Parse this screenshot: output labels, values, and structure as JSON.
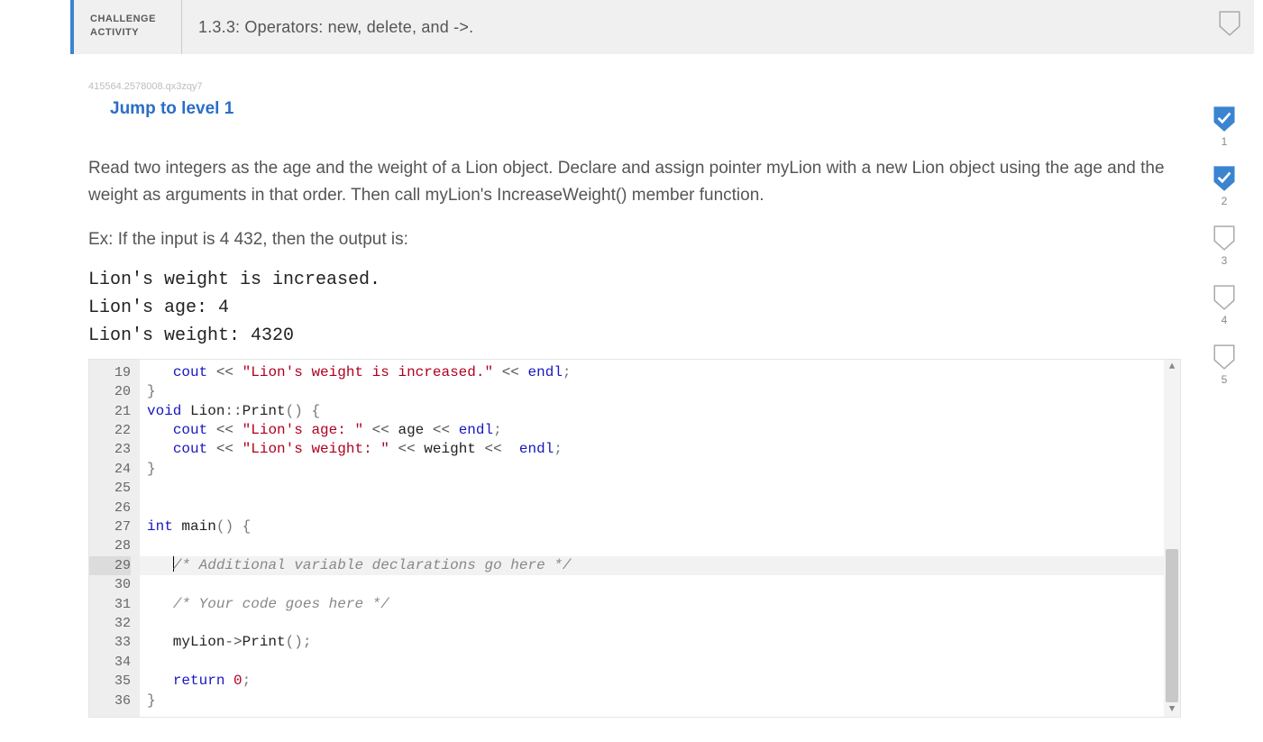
{
  "header": {
    "label_line1": "CHALLENGE",
    "label_line2": "ACTIVITY",
    "title": "1.3.3: Operators: new, delete, and ->."
  },
  "content_id": "415564.2578008.qx3zqy7",
  "jump_link": "Jump to level 1",
  "description": "Read two integers as the age and the weight of a Lion object. Declare and assign pointer myLion with a new Lion object using the age and the weight as arguments in that order. Then call myLion's IncreaseWeight() member function.",
  "example_label": "Ex: If the input is 4 432, then the output is:",
  "example_output": "Lion's weight is increased.\nLion's age: 4\nLion's weight: 4320",
  "progress": [
    {
      "n": "1",
      "done": true
    },
    {
      "n": "2",
      "done": true
    },
    {
      "n": "3",
      "done": false
    },
    {
      "n": "4",
      "done": false
    },
    {
      "n": "5",
      "done": false
    }
  ],
  "editor": {
    "first_line": 19,
    "selected_line": 29,
    "lines": [
      "   cout << \"Lion's weight is increased.\" << endl;",
      "}",
      "void Lion::Print() {",
      "   cout << \"Lion's age: \" << age << endl;",
      "   cout << \"Lion's weight: \" << weight <<  endl;",
      "}",
      "",
      "",
      "int main() {",
      "",
      "   /* Additional variable declarations go here */",
      "",
      "   /* Your code goes here */",
      "",
      "   myLion->Print();",
      "",
      "   return 0;",
      "}"
    ]
  }
}
